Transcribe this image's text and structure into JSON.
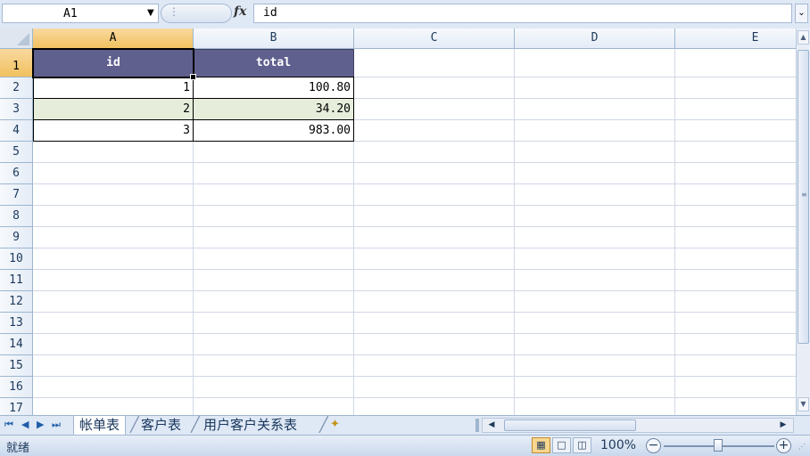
{
  "formula_bar": {
    "name_box": "A1",
    "fx_label": "fx",
    "formula": "id"
  },
  "columns": [
    "A",
    "B",
    "C",
    "D",
    "E"
  ],
  "rows": [
    "1",
    "2",
    "3",
    "4",
    "5",
    "6",
    "7",
    "8",
    "9",
    "10",
    "11",
    "12",
    "13",
    "14",
    "15",
    "16",
    "17"
  ],
  "table": {
    "headers": [
      "id",
      "total"
    ],
    "data": [
      [
        "1",
        "100.80"
      ],
      [
        "2",
        "34.20"
      ],
      [
        "3",
        "983.00"
      ]
    ]
  },
  "colors": {
    "header_fill": "#60608f",
    "alt_row_fill": "#e6eedb",
    "selected_header": "#f1c15f"
  },
  "sheet_tabs": [
    "帐单表",
    "客户表",
    "用户客户关系表"
  ],
  "active_sheet": "帐单表",
  "status": {
    "ready": "就绪",
    "zoom": "100%"
  }
}
